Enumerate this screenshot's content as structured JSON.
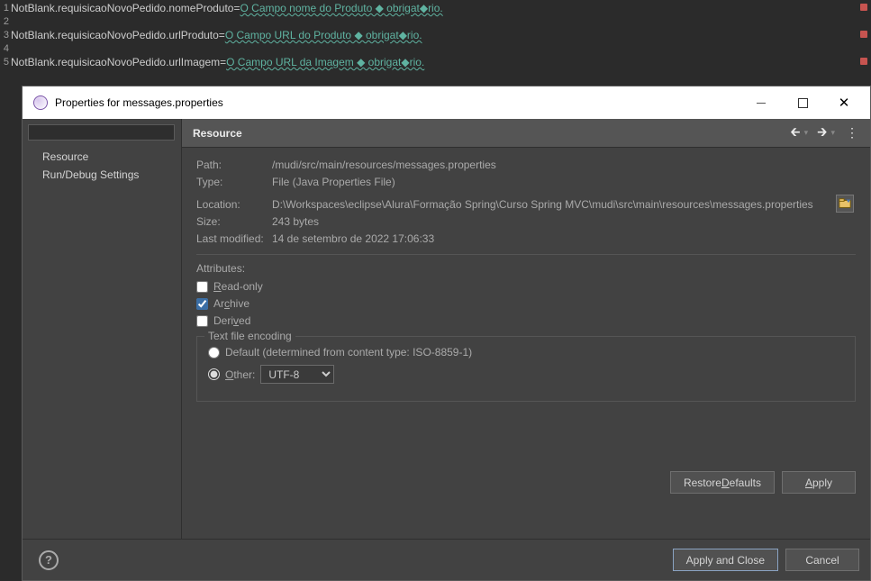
{
  "editor": {
    "lines": [
      {
        "n": "1",
        "key": "NotBlank.requisicaoNovoPedido.nomeProduto=",
        "val": "O Campo nome do Produto ◆ obrigat◆rio."
      },
      {
        "n": "2",
        "key": "",
        "val": ""
      },
      {
        "n": "3",
        "key": "NotBlank.requisicaoNovoPedido.urlProduto=",
        "val": "O Campo URL do Produto ◆ obrigat◆rio."
      },
      {
        "n": "4",
        "key": "",
        "val": ""
      },
      {
        "n": "5",
        "key": "NotBlank.requisicaoNovoPedido.urlImagem=",
        "val": "O Campo URL da Imagem ◆ obrigat◆rio."
      }
    ]
  },
  "dialog": {
    "title": "Properties for messages.properties",
    "left": {
      "filter_value": "",
      "items": [
        "Resource",
        "Run/Debug Settings"
      ],
      "selected_index": -1
    },
    "header": {
      "title": "Resource"
    },
    "resource": {
      "path_label": "Path:",
      "path_value": "/mudi/src/main/resources/messages.properties",
      "type_label": "Type:",
      "type_value": "File  (Java Properties File)",
      "location_label": "Location:",
      "location_value": "D:\\Workspaces\\eclipse\\Alura\\Formação Spring\\Curso Spring MVC\\mudi\\src\\main\\resources\\messages.properties",
      "size_label": "Size:",
      "size_value": "243  bytes",
      "lastmod_label": "Last modified:",
      "lastmod_value": "14 de setembro de 2022 17:06:33"
    },
    "attributes": {
      "heading": "Attributes:",
      "readonly_label": "Read-only",
      "readonly_checked": false,
      "archive_label": "Archive",
      "archive_checked": true,
      "derived_label": "Derived",
      "derived_checked": false
    },
    "encoding": {
      "legend": "Text file encoding",
      "default_label": "Default (determined from content type: ISO-8859-1)",
      "other_label": "Other:",
      "selected": "other",
      "other_value": "UTF-8"
    },
    "buttons": {
      "restore_defaults": "Restore Defaults",
      "apply": "Apply",
      "apply_close": "Apply and Close",
      "cancel": "Cancel"
    }
  }
}
